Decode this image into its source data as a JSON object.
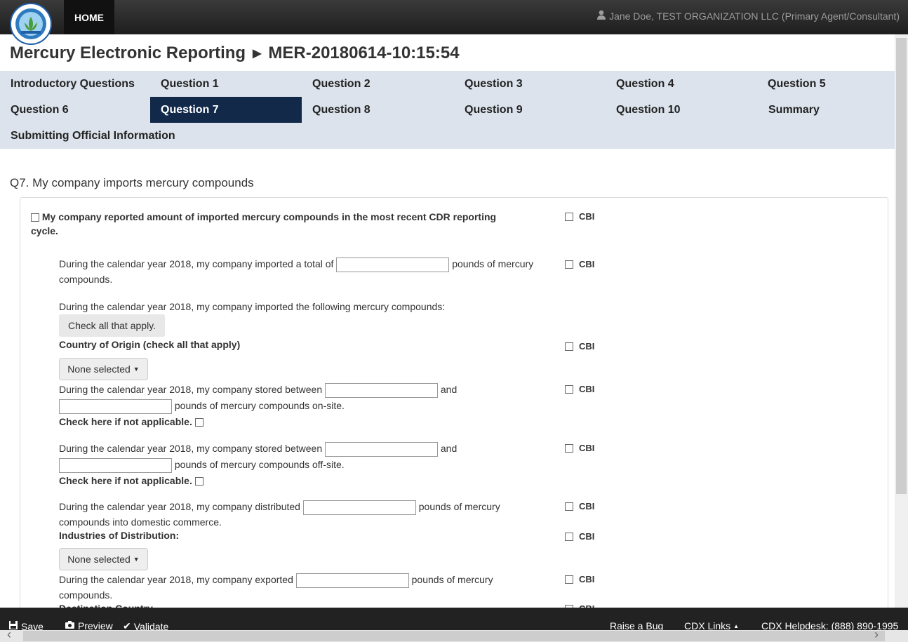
{
  "header": {
    "home_label": "HOME",
    "user_label": "Jane Doe, TEST ORGANIZATION LLC (Primary Agent/Consultant)"
  },
  "title": {
    "app": "Mercury Electronic Reporting",
    "report_id": "MER-20180614-10:15:54"
  },
  "nav": {
    "items": [
      {
        "label": "Introductory Questions"
      },
      {
        "label": "Question 1"
      },
      {
        "label": "Question 2"
      },
      {
        "label": "Question 3"
      },
      {
        "label": "Question 4"
      },
      {
        "label": "Question 5"
      },
      {
        "label": "Question 6"
      },
      {
        "label": "Question 7"
      },
      {
        "label": "Question 8"
      },
      {
        "label": "Question 9"
      },
      {
        "label": "Question 10"
      },
      {
        "label": "Summary"
      },
      {
        "label": "Submitting Official Information"
      }
    ],
    "active": "Question 7"
  },
  "question": {
    "header": "Q7. My company imports mercury compounds",
    "cdr_label": "My company reported amount of imported mercury compounds in the most recent CDR reporting cycle.",
    "cbi_label": "CBI",
    "import_total_pre": "During the calendar year 2018, my company imported a total of",
    "import_total_post": "pounds of mercury compounds.",
    "imported_following": "During the calendar year 2018, my company imported the following mercury compounds:",
    "check_all_button": "Check all that apply.",
    "country_origin_label": "Country of Origin (check all that apply)",
    "none_selected": "None selected",
    "stored_pre": "During the calendar year 2018, my company stored between",
    "and_label": "and",
    "stored_onsite_post": "pounds of mercury compounds on-site.",
    "stored_offsite_post": "pounds of mercury compounds off-site.",
    "not_applicable": "Check here if not applicable.",
    "distributed_pre": "During the calendar year 2018, my company distributed",
    "distributed_post": "pounds of mercury compounds into domestic commerce.",
    "industries_label": "Industries of Distribution:",
    "exported_pre": "During the calendar year 2018, my company exported",
    "exported_post": "pounds of mercury compounds.",
    "destination_label": "Destination Country"
  },
  "footer": {
    "save": "Save",
    "preview": "Preview",
    "validate": "Validate",
    "raise_bug": "Raise a Bug",
    "cdx_links": "CDX Links",
    "helpdesk": "CDX Helpdesk: (888) 890-1995"
  }
}
